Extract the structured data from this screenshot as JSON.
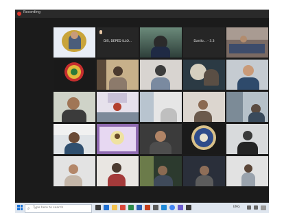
{
  "meeting": {
    "rec_label": "Recording"
  },
  "tiles": [
    {
      "label": ""
    },
    {
      "label": ""
    },
    {
      "label": ""
    },
    {
      "label": ""
    },
    {
      "label": ""
    },
    {
      "label": ""
    },
    {
      "label": ""
    },
    {
      "label": ""
    },
    {
      "label": ""
    },
    {
      "label": ""
    },
    {
      "label": ""
    },
    {
      "label": ""
    },
    {
      "label": ""
    },
    {
      "label": ""
    },
    {
      "label": ""
    },
    {
      "label": ""
    },
    {
      "label": ""
    },
    {
      "label": ""
    },
    {
      "label": ""
    },
    {
      "label": ""
    },
    {
      "label": ""
    },
    {
      "label": ""
    },
    {
      "label": ""
    },
    {
      "label": ""
    },
    {
      "label": ""
    }
  ],
  "text_tiles": {
    "t1": "DIS, DEPED ILLO...",
    "t2": "Danilo... - 3.3"
  },
  "taskbar": {
    "search_placeholder": "Type here to search",
    "tray_time": "",
    "tray_lang": "ENG"
  },
  "colors": {
    "screen_bg": "#1b1b1b",
    "active_tile_border": "#d6e66b",
    "taskbar_bg": "#dfe6ef",
    "recording_red": "#e0382e"
  }
}
